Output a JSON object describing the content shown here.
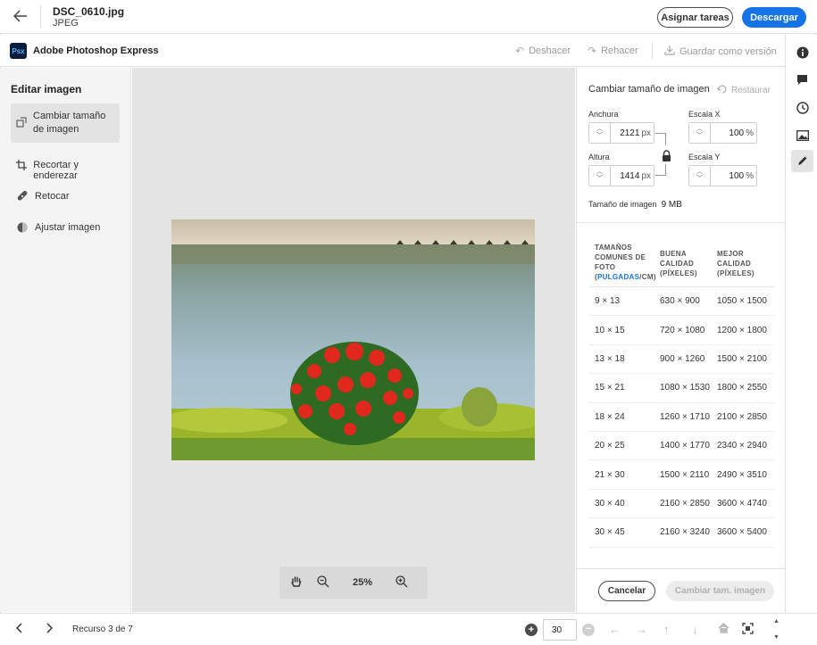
{
  "topbar": {
    "back_icon": "arrow-left-icon",
    "file_name": "DSC_0610.jpg",
    "file_type": "JPEG",
    "assign_label": "Asignar tareas",
    "download_label": "Descargar",
    "accent": "#1473e6"
  },
  "appbar": {
    "logo_text": "Psx",
    "app_name": "Adobe Photoshop Express",
    "undo_label": "Deshacer",
    "redo_label": "Rehacer",
    "save_version_label": "Guardar como versión"
  },
  "rail": {
    "items": [
      "info-icon",
      "comment-icon",
      "history-icon",
      "image-icon",
      "edit-icon"
    ]
  },
  "left_panel": {
    "title": "Editar imagen",
    "tools": [
      {
        "label": "Cambiar tamaño de imagen",
        "icon": "resize-icon",
        "active": true
      },
      {
        "label": "Recortar y enderezar",
        "icon": "crop-icon",
        "active": false
      },
      {
        "label": "Retocar",
        "icon": "healing-icon",
        "active": false
      },
      {
        "label": "Ajustar imagen",
        "icon": "adjust-icon",
        "active": false
      }
    ]
  },
  "canvas": {
    "zoom": "25%"
  },
  "resize_panel": {
    "title": "Cambiar tamaño de imagen",
    "restore_label": "Restaurar",
    "width_label": "Anchura",
    "width_value": "2121",
    "width_unit": "px",
    "height_label": "Altura",
    "height_value": "1414",
    "height_unit": "px",
    "scale_x_label": "Escala X",
    "scale_x_value": "100",
    "scale_y_label": "Escala Y",
    "scale_y_value": "100",
    "percent": "%",
    "image_size_label": "Tamaño de imagen",
    "image_size_value": "9 MB",
    "table": {
      "col1_line1": "TAMAÑOS",
      "col1_line2": "COMUNES DE",
      "col1_line3": "FOTO",
      "col1_link1": "PULGADAS",
      "col1_sep": "/",
      "col1_link2": "CM",
      "col2_line1": "BUENA",
      "col2_line2": "CALIDAD",
      "col2_line3": "(PÍXELES)",
      "col3_line1": "MEJOR",
      "col3_line2": "CALIDAD",
      "col3_line3": "(PÍXELES)",
      "rows": [
        {
          "size": "9 × 13",
          "good": "630 × 900",
          "best": "1050 × 1500"
        },
        {
          "size": "10 × 15",
          "good": "720 × 1080",
          "best": "1200 × 1800"
        },
        {
          "size": "13 × 18",
          "good": "900 × 1260",
          "best": "1500 × 2100"
        },
        {
          "size": "15 × 21",
          "good": "1080 × 1530",
          "best": "1800 × 2550"
        },
        {
          "size": "18 × 24",
          "good": "1260 × 1710",
          "best": "2100 × 2850"
        },
        {
          "size": "20 × 25",
          "good": "1400 × 1770",
          "best": "2340 × 2940"
        },
        {
          "size": "21 × 30",
          "good": "1500 × 2110",
          "best": "2490 × 3510"
        },
        {
          "size": "30 × 40",
          "good": "2160 × 2850",
          "best": "3600 × 4740"
        },
        {
          "size": "30 × 45",
          "good": "2160 × 3240",
          "best": "3600 × 5400"
        }
      ]
    },
    "cancel_label": "Cancelar",
    "apply_label": "Cambiar tam. imagen"
  },
  "bottombar": {
    "resource_text": "Recurso 3 de 7",
    "page_value": "30"
  }
}
